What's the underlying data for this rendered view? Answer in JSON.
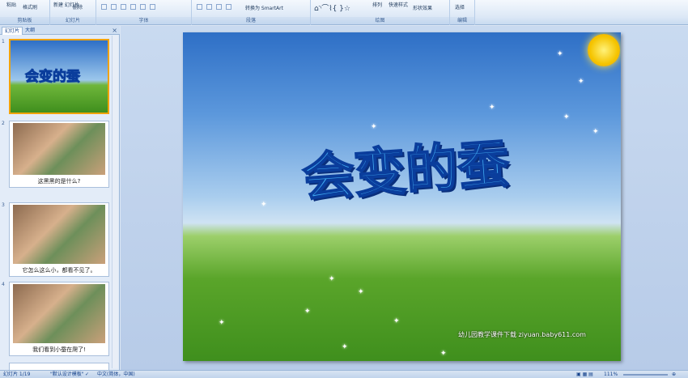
{
  "ribbon": {
    "paste": "粘贴",
    "format_painter": "格式刷",
    "new_slide": "新建\n幻灯片",
    "delete": "删除",
    "convert_smartart": "转换为 SmartArt",
    "arrange": "排列",
    "quick_styles": "快速样式",
    "shape_effects": "形状效果",
    "select": "选择",
    "groups": [
      "剪贴板",
      "幻灯片",
      "字体",
      "段落",
      "绘图",
      "编辑"
    ]
  },
  "panel": {
    "tabs": [
      "幻灯片",
      "大纲"
    ],
    "close": "×"
  },
  "slides": [
    {
      "num": "1",
      "caption": "",
      "thumb_title": "会变的蚕"
    },
    {
      "num": "2",
      "caption": "这黑黑的是什么?"
    },
    {
      "num": "3",
      "caption": "它怎么这么小，都看不见了。"
    },
    {
      "num": "4",
      "caption": "我们看到小蚕在爬了!"
    }
  ],
  "slide": {
    "title": "会变的蚕",
    "watermark": "幼儿园教学课件下载 ziyuan.baby611.com"
  },
  "status": {
    "slide_counter": "幻灯片 1/19",
    "theme": "\"默认设计模板\"",
    "language": "中文(简体，中国)",
    "zoom": "111%"
  },
  "colors": {
    "accent": "#f0a30a",
    "ribbon": "#dce8f6"
  }
}
